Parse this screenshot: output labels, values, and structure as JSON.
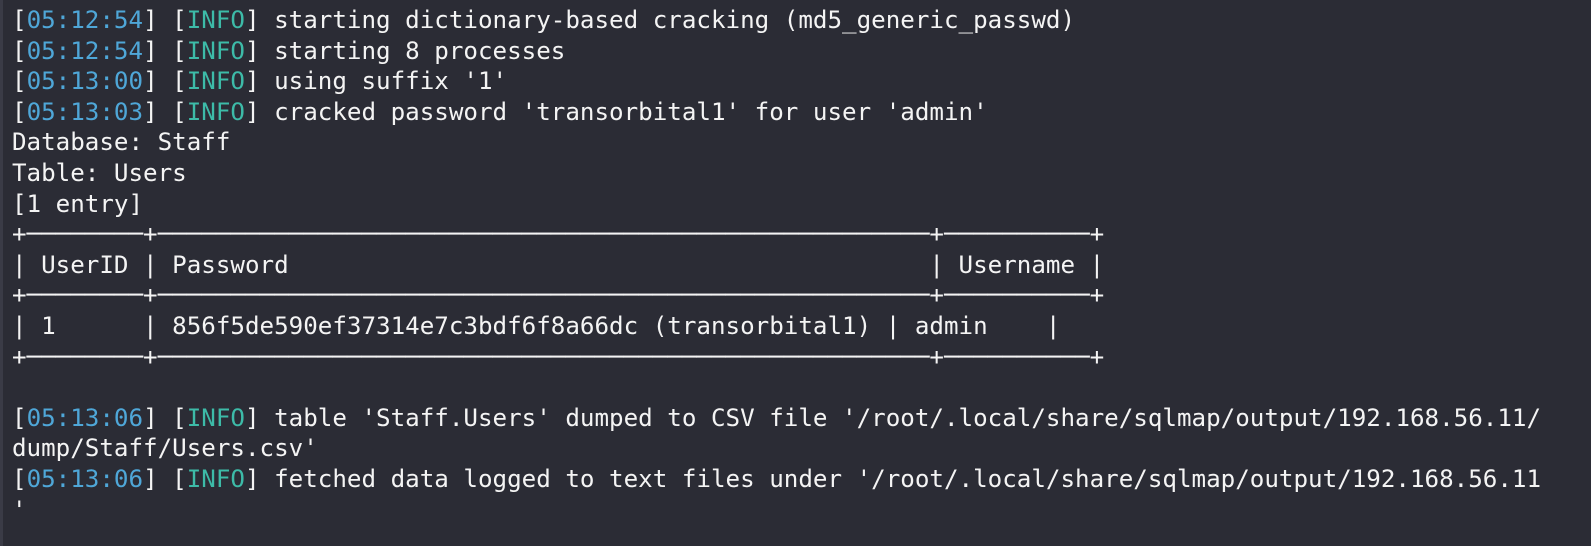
{
  "colors": {
    "background": "#2b2c35",
    "text": "#f4f4f4",
    "timestamp": "#4fa7d8",
    "level": "#3dbba8"
  },
  "log_top": [
    {
      "time": "05:12:54",
      "level": "INFO",
      "message": "starting dictionary-based cracking (md5_generic_passwd)"
    },
    {
      "time": "05:12:54",
      "level": "INFO",
      "message": "starting 8 processes"
    },
    {
      "time": "05:13:00",
      "level": "INFO",
      "message": "using suffix '1'"
    },
    {
      "time": "05:13:03",
      "level": "INFO",
      "message": "cracked password 'transorbital1' for user 'admin'"
    }
  ],
  "dump": {
    "database_line": "Database: Staff",
    "table_line": "Table: Users",
    "entries_line": "[1 entry]",
    "border_line": "+────────+─────────────────────────────────────────────────────+──────────+",
    "header_row": "| UserID | Password                                            | Username |",
    "data_row": "| 1      | 856f5de590ef37314e7c3bdf6f8a66dc (transorbital1) | admin    |"
  },
  "log_bottom": [
    {
      "time": "05:13:06",
      "level": "INFO",
      "message": "table 'Staff.Users' dumped to CSV file '/root/.local/share/sqlmap/output/192.168.56.11/",
      "continuation": "dump/Staff/Users.csv'"
    },
    {
      "time": "05:13:06",
      "level": "INFO",
      "message": "fetched data logged to text files under '/root/.local/share/sqlmap/output/192.168.56.11",
      "continuation": "'"
    }
  ]
}
